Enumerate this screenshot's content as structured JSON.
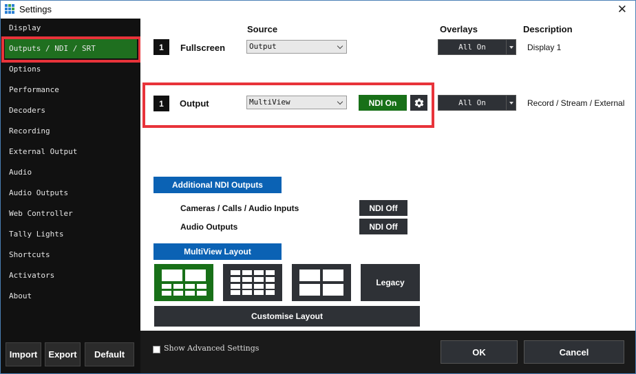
{
  "window": {
    "title": "Settings"
  },
  "sidebar": {
    "items": [
      {
        "label": "Display"
      },
      {
        "label": "Outputs / NDI / SRT",
        "active": true
      },
      {
        "label": "Options"
      },
      {
        "label": "Performance"
      },
      {
        "label": "Decoders"
      },
      {
        "label": "Recording"
      },
      {
        "label": "External Output"
      },
      {
        "label": "Audio"
      },
      {
        "label": "Audio Outputs"
      },
      {
        "label": "Web Controller"
      },
      {
        "label": "Tally Lights"
      },
      {
        "label": "Shortcuts"
      },
      {
        "label": "Activators"
      },
      {
        "label": "About"
      }
    ],
    "buttons": {
      "import": "Import",
      "export": "Export",
      "default": "Default"
    }
  },
  "columns": {
    "source": "Source",
    "overlays": "Overlays",
    "description": "Description"
  },
  "rows": [
    {
      "number": "1",
      "label": "Fullscreen",
      "source": "Output",
      "overlays": "All On",
      "description": "Display 1"
    },
    {
      "number": "1",
      "label": "Output",
      "source": "MultiView",
      "ndi": "NDI On",
      "overlays": "All On",
      "description": "Record / Stream / External"
    }
  ],
  "additional_ndi": {
    "header": "Additional NDI Outputs",
    "items": [
      {
        "label": "Cameras / Calls / Audio Inputs",
        "state": "NDI Off"
      },
      {
        "label": "Audio Outputs",
        "state": "NDI Off"
      }
    ]
  },
  "multiview": {
    "header": "MultiView Layout",
    "legacy_label": "Legacy",
    "customise_label": "Customise Layout"
  },
  "bottom": {
    "advanced_label": "Show Advanced Settings",
    "ok": "OK",
    "cancel": "Cancel"
  },
  "colors": {
    "accent_green": "#187018",
    "accent_blue": "#0b62b4",
    "highlight_red": "#e8333a",
    "dark_button": "#2e3136"
  }
}
